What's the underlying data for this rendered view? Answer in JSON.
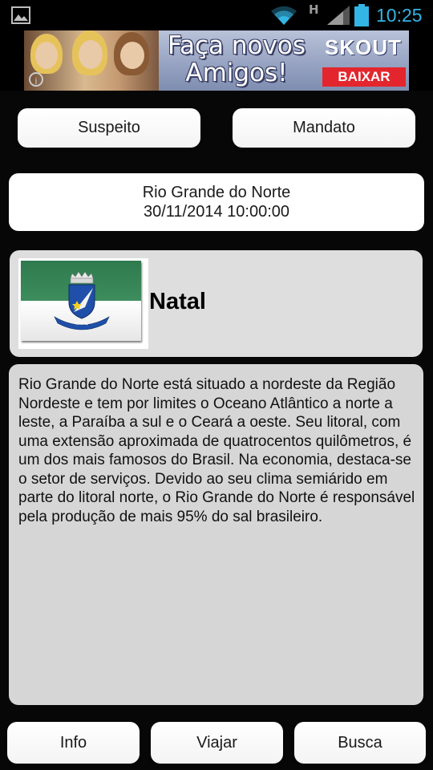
{
  "status_bar": {
    "time": "10:25",
    "network_type": "H",
    "icons": [
      "gallery-icon",
      "wifi-icon",
      "signal-icon",
      "battery-icon"
    ],
    "clock_color": "#33b5e5"
  },
  "ad": {
    "headline": "Faça novos\nAmigos!",
    "brand": "SKOUT",
    "cta": "BAIXAR",
    "cta_color": "#e3262e"
  },
  "top_buttons": {
    "suspect_label": "Suspeito",
    "warrant_label": "Mandato"
  },
  "case_info": {
    "state": "Rio Grande do Norte",
    "datetime": "30/11/2014 10:00:00"
  },
  "city": {
    "name": "Natal",
    "flag_colors": {
      "top": "#2f7a4e",
      "bottom": "#ffffff"
    }
  },
  "description": "Rio Grande do Norte está situado a nordeste da Região Nordeste e tem por limites o Oceano Atlântico a norte a leste, a Paraíba a sul e o Ceará a oeste. Seu litoral, com uma extensão aproximada de quatrocentos quilômetros, é um dos mais famosos do Brasil. Na economia, destaca-se o setor de serviços. Devido ao seu clima semiárido em parte do litoral norte, o Rio Grande do Norte é responsável pela produção de mais 95% do sal brasileiro.",
  "bottom_nav": {
    "info_label": "Info",
    "travel_label": "Viajar",
    "search_label": "Busca"
  }
}
